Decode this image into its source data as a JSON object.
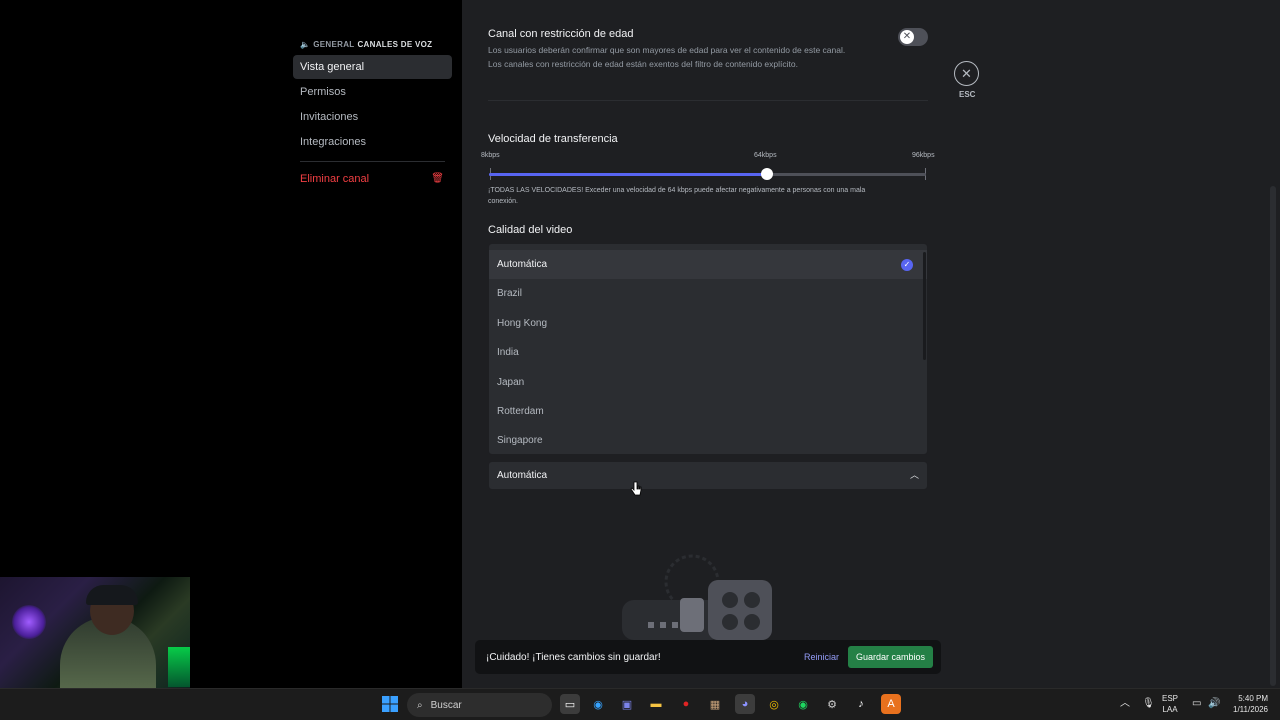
{
  "breadcrumb": {
    "channel": "GENERAL",
    "section": "CANALES DE VOZ"
  },
  "sidebar": {
    "items": [
      {
        "label": "Vista general"
      },
      {
        "label": "Permisos"
      },
      {
        "label": "Invitaciones"
      },
      {
        "label": "Integraciones"
      }
    ],
    "delete_label": "Eliminar canal"
  },
  "age_restriction": {
    "title": "Canal con restricción de edad",
    "desc1": "Los usuarios deberán confirmar que son mayores de edad para ver el contenido de este canal.",
    "desc2": "Los canales con restricción de edad están exentos del filtro de contenido explícito.",
    "enabled": false
  },
  "esc_label": "ESC",
  "bitrate": {
    "title": "Velocidad de transferencia",
    "min_label": "8kbps",
    "mid_label": "64kbps",
    "max_label": "96kbps",
    "value_kbps": 64,
    "warning1": "¡TODAS LAS VELOCIDADES! Exceder una velocidad de 64 kbps puede afectar negativamente a personas con una mala",
    "warning2": "conexión."
  },
  "video_quality": {
    "title": "Calidad del video"
  },
  "region_dropdown": {
    "options": [
      "Automática",
      "Brazil",
      "Hong Kong",
      "India",
      "Japan",
      "Rotterdam",
      "Singapore"
    ],
    "selected": "Automática"
  },
  "unsaved_bar": {
    "message": "¡Cuidado! ¡Tienes cambios sin guardar!",
    "reset_label": "Reiniciar",
    "save_label": "Guardar cambios"
  },
  "taskbar": {
    "search_placeholder": "Buscar",
    "lang_top": "ESP",
    "lang_bottom": "LAA",
    "time": "5:40 PM",
    "date": "1/11/2026"
  },
  "colors": {
    "accent": "#5865f2",
    "danger": "#f23f43",
    "save": "#248046"
  }
}
